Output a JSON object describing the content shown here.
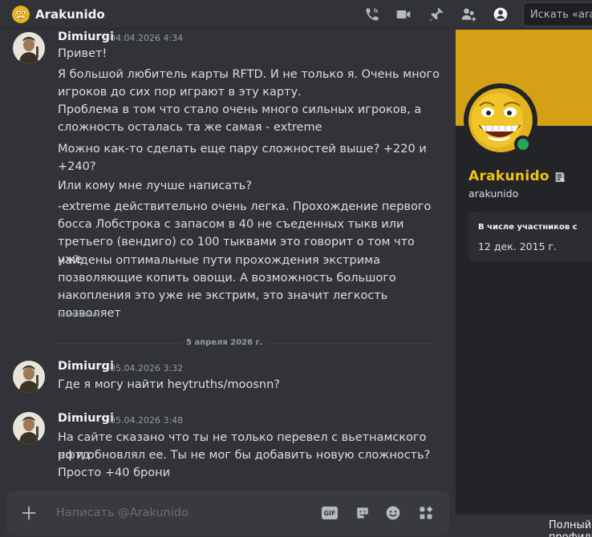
{
  "header": {
    "title": "Arakunido",
    "search_placeholder": "Искать «arakunido»",
    "icons": [
      "phone-call-icon",
      "video-call-icon",
      "pin-icon",
      "add-friend-icon",
      "profile-toggle-icon"
    ]
  },
  "messages": [
    {
      "author": "Dimiurgi",
      "time": "04.04.2026 4:34",
      "lines": [
        "Привет!",
        "Я большой любитель карты RFTD. И не только я. Очень много",
        "игроков до сих пор играют в эту карту.",
        "Проблема в том что стало очень много сильных игроков, а",
        "сложность осталась та же самая - extreme",
        "Можно как-то сделать еще пару сложностей выше? +220 и",
        "+240?",
        "Или кому мне лучше написать?",
        "-extreme действительно очень легка. Прохождение первого",
        "босса Лобстрока с запасом в 40 не съеденных тыкв или",
        "третьего (вендиго) со 100 тыквами это говорит о том что уже",
        "найдены оптимальные пути прохождения экстрима",
        "позволяющие копить овощи. А возможность большого",
        "накопления это уже не экстрим, это значит легкость позволяет"
      ],
      "edited": "(изменено)"
    },
    {
      "author": "Dimiurgi",
      "time": "05.04.2026 3:32",
      "lines": [
        "Где я могу найти heytruths/moosnn?"
      ]
    },
    {
      "author": "Dimiurgi",
      "time": "05.04.2026 3:48",
      "lines": [
        "На сайте сказано что ты не только перевел с вьетнамского рфтд",
        "но и обновлял ее. Ты не мог бы добавить новую сложность?",
        "Просто +40 брони"
      ]
    }
  ],
  "date_divider": "5 апреля 2026 г.",
  "composer": {
    "placeholder": "Написать @Arakunido",
    "icons": [
      "plus-icon",
      "gif-icon",
      "sticker-icon",
      "emoji-icon",
      "apps-icon"
    ],
    "gif_label": "GIF"
  },
  "profile": {
    "display_name": "Arakunido",
    "username": "arakunido",
    "member_since_label": "В числе участников с",
    "member_since_date": "12 дек. 2015 г.",
    "status": "online",
    "banner_color": "#d4a017",
    "name_color": "#f0c414",
    "footer_link": "Полный профиль"
  },
  "colors": {
    "background": "#313338",
    "panel": "#232428",
    "status_online": "#23a55a"
  }
}
